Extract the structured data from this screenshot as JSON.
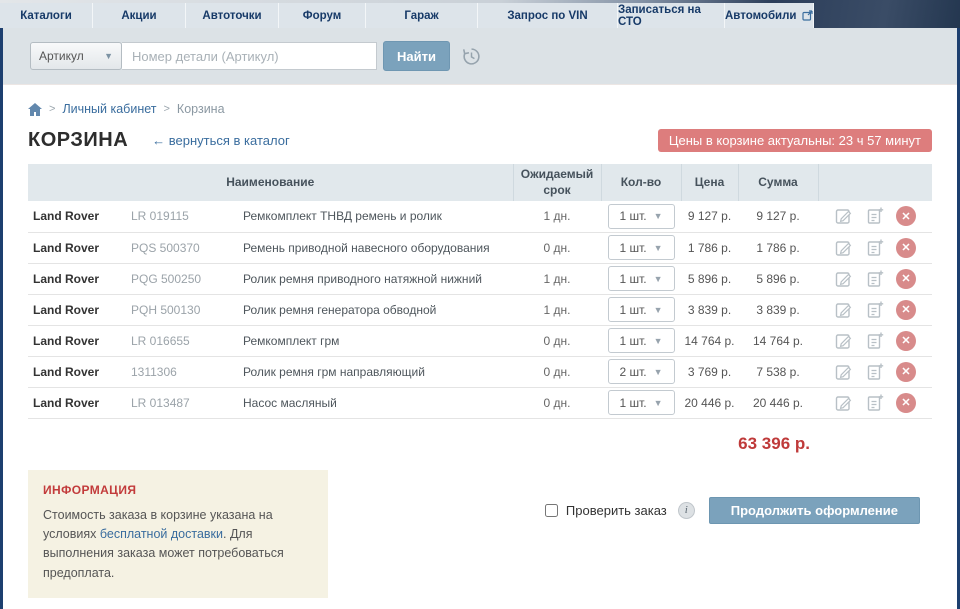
{
  "nav": {
    "items": [
      {
        "label": "Каталоги"
      },
      {
        "label": "Акции"
      },
      {
        "label": "Автоточки"
      },
      {
        "label": "Форум"
      },
      {
        "label": "Гараж"
      },
      {
        "label": "Запрос по VIN"
      },
      {
        "label": "Записаться на СТО"
      },
      {
        "label": "Автомобили",
        "external": true
      }
    ]
  },
  "search": {
    "category": "Артикул",
    "placeholder": "Номер детали (Артикул)",
    "button": "Найти"
  },
  "breadcrumb": {
    "link1": "Личный кабинет",
    "current": "Корзина"
  },
  "page": {
    "title": "КОРЗИНА",
    "back_link": "← вернуться в каталог",
    "prices_badge": "Цены в корзине актуальны: 23 ч 57 минут"
  },
  "table": {
    "headers": {
      "name": "Наименование",
      "term": "Ожидаемый срок",
      "qty": "Кол-во",
      "price": "Цена",
      "sum": "Сумма"
    },
    "rows": [
      {
        "brand": "Land Rover",
        "article": "LR 019115",
        "name": "Ремкомплект ТНВД ремень и ролик",
        "term": "1 дн.",
        "qty": "1 шт.",
        "price": "9 127 р.",
        "sum": "9 127 р."
      },
      {
        "brand": "Land Rover",
        "article": "PQS 500370",
        "name": "Ремень приводной навесного оборудования",
        "term": "0 дн.",
        "qty": "1 шт.",
        "price": "1 786 р.",
        "sum": "1 786 р."
      },
      {
        "brand": "Land Rover",
        "article": "PQG 500250",
        "name": "Ролик ремня приводного натяжной нижний",
        "term": "1 дн.",
        "qty": "1 шт.",
        "price": "5 896 р.",
        "sum": "5 896 р."
      },
      {
        "brand": "Land Rover",
        "article": "PQH 500130",
        "name": "Ролик ремня генератора обводной",
        "term": "1 дн.",
        "qty": "1 шт.",
        "price": "3 839 р.",
        "sum": "3 839 р."
      },
      {
        "brand": "Land Rover",
        "article": "LR 016655",
        "name": "Ремкомплект грм",
        "term": "0 дн.",
        "qty": "1 шт.",
        "price": "14 764 р.",
        "sum": "14 764 р."
      },
      {
        "brand": "Land Rover",
        "article": "1311306",
        "name": "Ролик ремня грм направляющий",
        "term": "0 дн.",
        "qty": "2 шт.",
        "price": "3 769 р.",
        "sum": "7 538 р."
      },
      {
        "brand": "Land Rover",
        "article": "LR 013487",
        "name": "Насос масляный",
        "term": "0 дн.",
        "qty": "1 шт.",
        "price": "20 446 р.",
        "sum": "20 446 р."
      }
    ],
    "total": "63 396 р."
  },
  "info_box": {
    "title": "ИНФОРМАЦИЯ",
    "text_before": "Стоимость заказа в корзине указана на условиях ",
    "link": "бесплатной доставки",
    "text_after": ". Для выполнения заказа может потребоваться предоплата."
  },
  "checkout": {
    "checkbox_label": "Проверить заказ",
    "button": "Продолжить оформление"
  },
  "colors": {
    "navy_border": "#1d3f6f",
    "nav_text": "#173a68",
    "badge_red": "#dd7d7d",
    "total_red": "#bf3a3a",
    "link_blue": "#3a6d9e",
    "button_blue": "#7ba2bc",
    "header_bg": "#e1e8ec",
    "info_bg": "#f5f2e3"
  }
}
